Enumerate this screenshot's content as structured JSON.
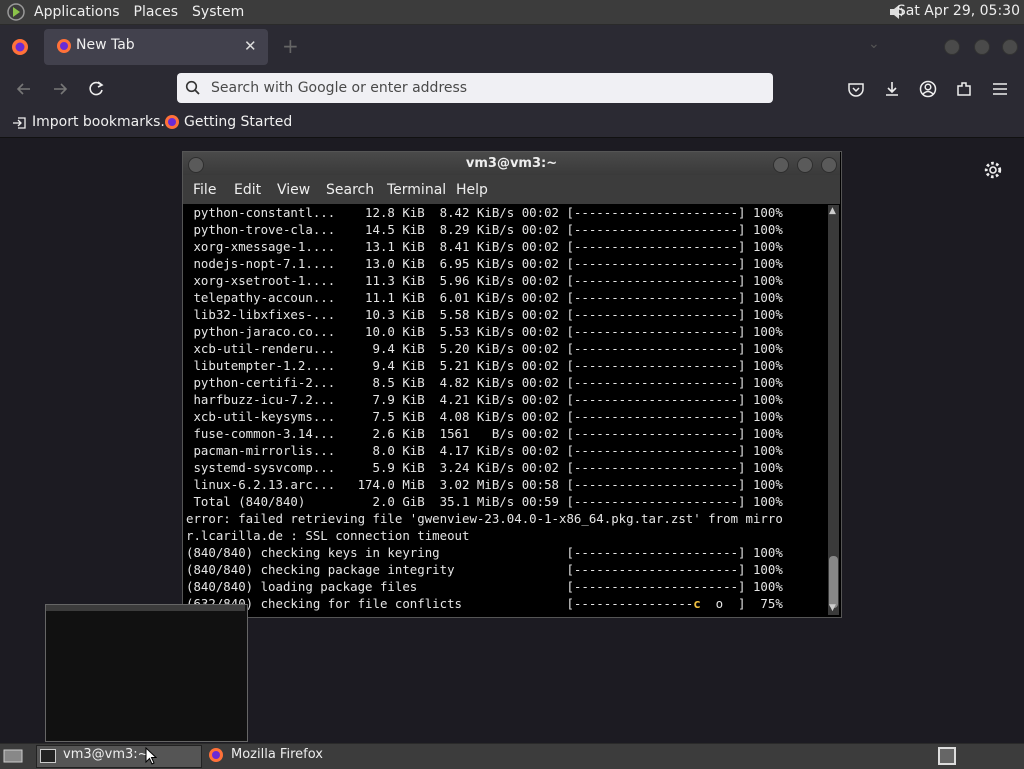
{
  "top_panel": {
    "menus": [
      "Applications",
      "Places",
      "System"
    ],
    "clock": "Sat Apr 29, 05:30"
  },
  "browser": {
    "tab_title": "New Tab",
    "url_placeholder": "Search with Google or enter address",
    "bookmarks": [
      "Import bookmarks...",
      "Getting Started"
    ]
  },
  "terminal": {
    "title": "vm3@vm3:~",
    "menus": [
      "File",
      "Edit",
      "View",
      "Search",
      "Terminal",
      "Help"
    ],
    "lines": [
      " python-constantl...    12.8 KiB  8.42 KiB/s 00:02 [----------------------] 100%",
      " python-trove-cla...    14.5 KiB  8.29 KiB/s 00:02 [----------------------] 100%",
      " xorg-xmessage-1....    13.1 KiB  8.41 KiB/s 00:02 [----------------------] 100%",
      " nodejs-nopt-7.1....    13.0 KiB  6.95 KiB/s 00:02 [----------------------] 100%",
      " xorg-xsetroot-1....    11.3 KiB  5.96 KiB/s 00:02 [----------------------] 100%",
      " telepathy-accoun...    11.1 KiB  6.01 KiB/s 00:02 [----------------------] 100%",
      " lib32-libxfixes-...    10.3 KiB  5.58 KiB/s 00:02 [----------------------] 100%",
      " python-jaraco.co...    10.0 KiB  5.53 KiB/s 00:02 [----------------------] 100%",
      " xcb-util-renderu...     9.4 KiB  5.20 KiB/s 00:02 [----------------------] 100%",
      " libutempter-1.2....     9.4 KiB  5.21 KiB/s 00:02 [----------------------] 100%",
      " python-certifi-2...     8.5 KiB  4.82 KiB/s 00:02 [----------------------] 100%",
      " harfbuzz-icu-7.2...     7.9 KiB  4.21 KiB/s 00:02 [----------------------] 100%",
      " xcb-util-keysyms...     7.5 KiB  4.08 KiB/s 00:02 [----------------------] 100%",
      " fuse-common-3.14...     2.6 KiB  1561   B/s 00:02 [----------------------] 100%",
      " pacman-mirrorlis...     8.0 KiB  4.17 KiB/s 00:02 [----------------------] 100%",
      " systemd-sysvcomp...     5.9 KiB  3.24 KiB/s 00:02 [----------------------] 100%",
      " linux-6.2.13.arc...   174.0 MiB  3.02 MiB/s 00:58 [----------------------] 100%",
      " Total (840/840)         2.0 GiB  35.1 MiB/s 00:59 [----------------------] 100%",
      "error: failed retrieving file 'gwenview-23.04.0-1-x86_64.pkg.tar.zst' from mirro",
      "r.lcarilla.de : SSL connection timeout",
      "(840/840) checking keys in keyring                 [----------------------] 100%",
      "(840/840) checking package integrity               [----------------------] 100%",
      "(840/840) loading package files                    [----------------------] 100%"
    ],
    "progress_line_prefix": "(632/840) checking for file conflicts              [----------------",
    "progress_pacman": "c",
    "progress_line_suffix": "  o  ]  75%"
  },
  "taskbar": {
    "items": [
      "vm3@vm3:~",
      "Mozilla Firefox"
    ]
  }
}
